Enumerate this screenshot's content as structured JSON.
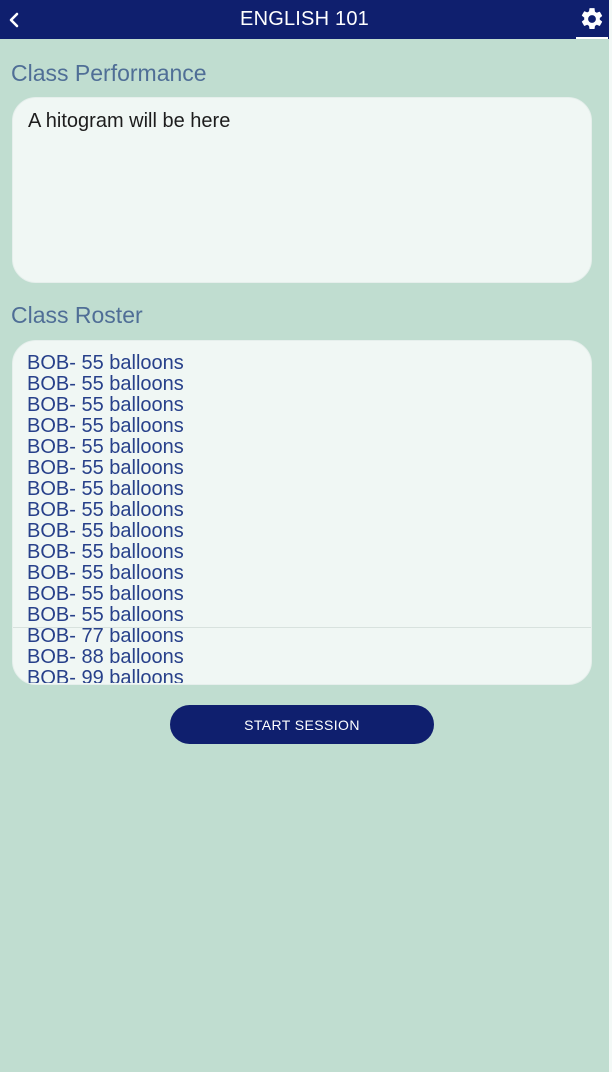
{
  "header": {
    "title": "ENGLISH 101",
    "back_icon": "chevron-left-icon",
    "settings_icon": "gear-icon"
  },
  "performance": {
    "heading": "Class Performance",
    "placeholder": "A hitogram will be here"
  },
  "roster": {
    "heading": "Class Roster",
    "items": [
      "BOB- 55 balloons",
      "BOB- 55 balloons",
      "BOB- 55 balloons",
      "BOB- 55 balloons",
      "BOB- 55 balloons",
      "BOB- 55 balloons",
      "BOB- 55 balloons",
      "BOB- 55 balloons",
      "BOB- 55 balloons",
      "BOB- 55 balloons",
      "BOB- 55 balloons",
      "BOB- 55 balloons",
      "BOB- 55 balloons",
      "BOB- 77 balloons",
      "BOB- 88 balloons",
      "BOB- 99 balloons"
    ]
  },
  "actions": {
    "start_session_label": "START SESSION"
  },
  "colors": {
    "primary": "#0f1f6e",
    "background": "#c0ddd0",
    "card": "#f0f7f4",
    "heading": "#4f6e96",
    "roster_text": "#27408a"
  }
}
